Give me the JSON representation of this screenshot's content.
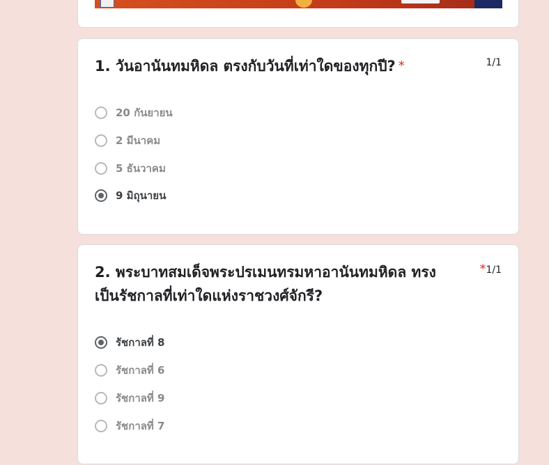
{
  "q1": {
    "title": "1. วันอานันทมหิดล ตรงกับวันที่เท่าใดของทุกปี?",
    "required_mark": "*",
    "score": "1/1",
    "options": [
      {
        "label": "20 กันยายน",
        "selected": false
      },
      {
        "label": "2 มีนาคม",
        "selected": false
      },
      {
        "label": "5 ธันวาคม",
        "selected": false
      },
      {
        "label": "9 มิถุนายน",
        "selected": true
      }
    ]
  },
  "q2": {
    "title_line1": "2. พระบาทสมเด็จพระปรเมนทรมหาอานันทมหิดล ทรง",
    "title_line2": "เป็นรัชกาลที่เท่าใดแห่งราชวงศ์จักรี?",
    "required_mark": "*",
    "score": "1/1",
    "options": [
      {
        "label": "รัชกาลที่ 8",
        "selected": true
      },
      {
        "label": "รัชกาลที่ 6",
        "selected": false
      },
      {
        "label": "รัชกาลที่ 9",
        "selected": false
      },
      {
        "label": "รัชกาลที่ 7",
        "selected": false
      }
    ]
  },
  "colors": {
    "page_background": "#f6e0db",
    "required": "#d93025",
    "selected_radio": "#5f6368"
  }
}
